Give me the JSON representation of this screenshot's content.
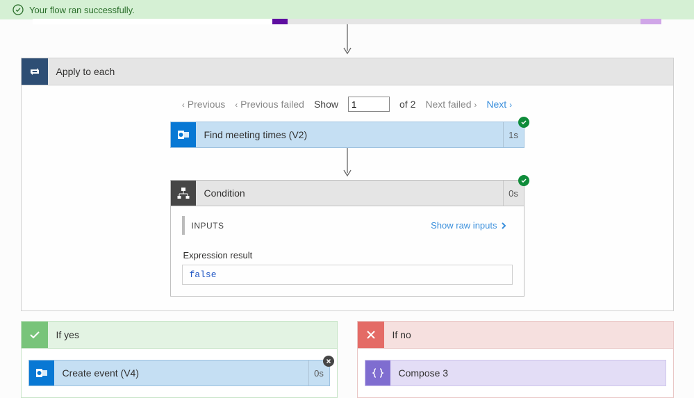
{
  "banner": {
    "text": "Your flow ran successfully."
  },
  "apply": {
    "title": "Apply to each",
    "pager": {
      "prev": "Previous",
      "prevFailed": "Previous failed",
      "showLabel": "Show",
      "value": "1",
      "ofTotal": "of 2",
      "nextFailed": "Next failed",
      "next": "Next"
    },
    "step1": {
      "title": "Find meeting times (V2)",
      "duration": "1s"
    },
    "cond": {
      "title": "Condition",
      "duration": "0s",
      "inputsLabel": "INPUTS",
      "showRaw": "Show raw inputs",
      "exprLabel": "Expression result",
      "exprValue": "false"
    }
  },
  "branches": {
    "yes": {
      "title": "If yes",
      "step": {
        "title": "Create event (V4)",
        "duration": "0s"
      }
    },
    "no": {
      "title": "If no",
      "step": {
        "title": "Compose 3"
      }
    }
  }
}
